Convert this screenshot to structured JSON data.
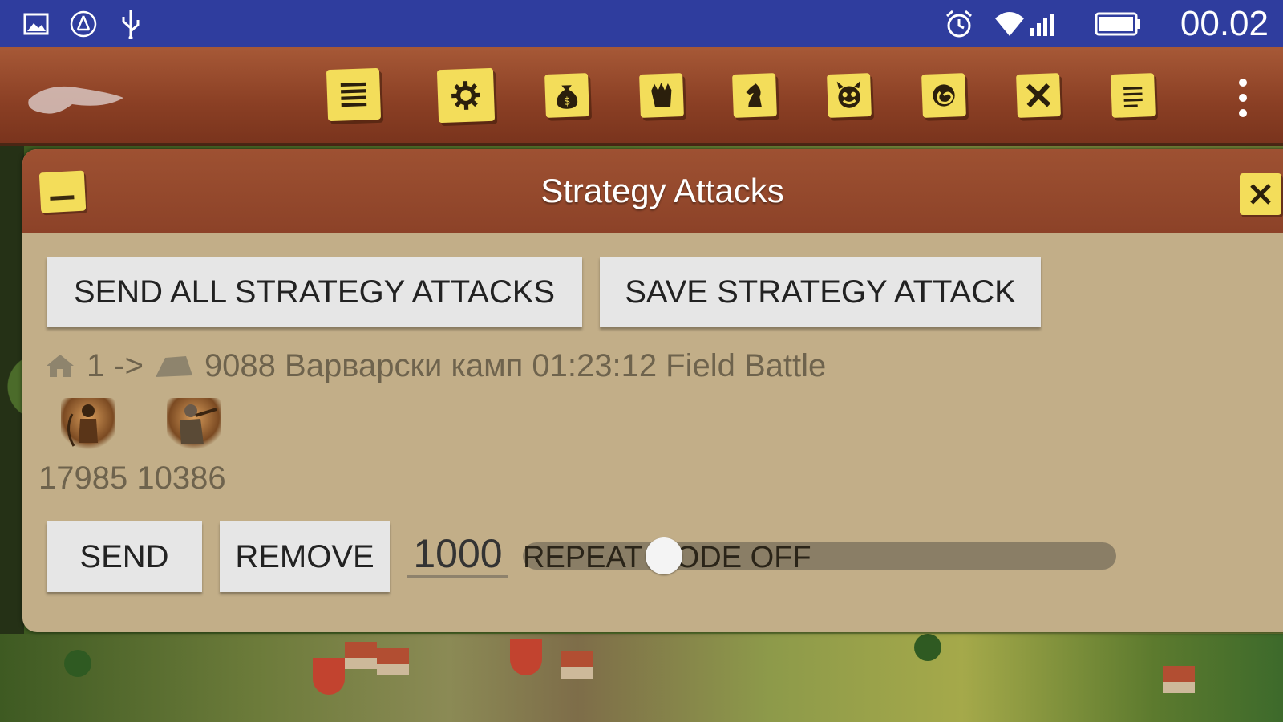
{
  "status_bar": {
    "time": "00.02",
    "icons": [
      "image-icon",
      "network-sharing-icon",
      "usb-icon",
      "alarm-icon",
      "wifi-icon",
      "signal-icon",
      "battery-icon"
    ]
  },
  "toolbar": {
    "icons": [
      "list-icon",
      "gear-icon",
      "money-bag-icon",
      "fist-icon",
      "chess-knight-icon",
      "devil-icon",
      "spiral-icon",
      "close-icon",
      "notes-icon",
      "overflow-menu-icon"
    ]
  },
  "dialog": {
    "title": "Strategy Attacks",
    "send_all_label": "SEND ALL STRATEGY ATTACKS",
    "save_label": "SAVE STRATEGY ATTACK",
    "attack_from": "1",
    "attack_arrow": "->",
    "attack_target": "9088 Варварски камп 01:23:12 Field Battle",
    "unit_counts": "17985 10386",
    "send_label": "SEND",
    "remove_label": "REMOVE",
    "amount_value": "1000",
    "repeat_mode_label": "REPEAT MODE OFF",
    "repeat_slider_level": 0.22
  },
  "colors": {
    "status_bar": "#2f3d9e",
    "app_bar": "#8a3f24",
    "note_yellow": "#f3dd5a",
    "dialog_body": "#c2ae88",
    "button_face": "#e6e6e6"
  }
}
